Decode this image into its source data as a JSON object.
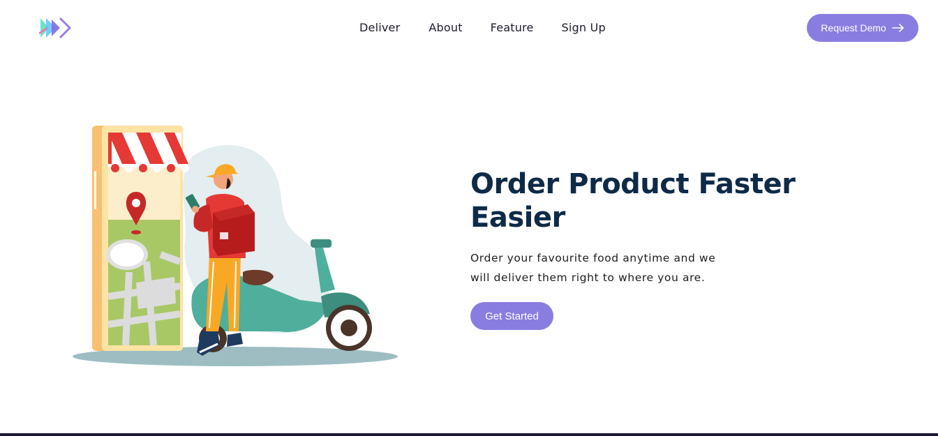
{
  "header": {
    "logo_icon": "chevrons-right-logo-icon",
    "nav": {
      "deliver": "Deliver",
      "about": "About",
      "feature": "Feature",
      "signup": "Sign Up"
    },
    "demo_button": {
      "label": "Request Demo",
      "icon": "arrow-right-icon"
    }
  },
  "hero": {
    "title_line1": "Order Product Faster",
    "title_line2": "Easier",
    "description_line1": "Order your favourite food anytime and we",
    "description_line2": "will deliver them right to where you are.",
    "cta_label": "Get Started",
    "illustration": "delivery-courier-scooter-illustration"
  },
  "colors": {
    "accent": "#8a7de1",
    "heading": "#0e2a47",
    "text": "#1d1d1d",
    "footer_bar": "#1c1a33"
  }
}
